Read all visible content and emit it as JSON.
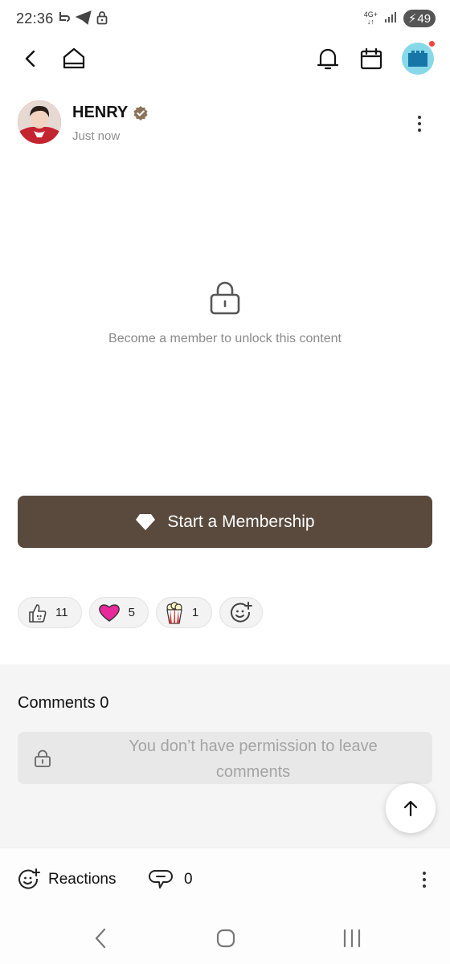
{
  "status_bar": {
    "time": "22:36",
    "network": "4G+",
    "battery": "49",
    "icons": [
      "sync-icon",
      "telegram-icon",
      "lock-icon",
      "signal-icon",
      "battery-icon"
    ]
  },
  "top_nav": {
    "icons": [
      "back-icon",
      "home-icon",
      "bell-icon",
      "calendar-icon",
      "profile-avatar"
    ],
    "has_notification_dot": true
  },
  "post": {
    "author_name": "HENRY",
    "verified": true,
    "timestamp": "Just now",
    "locked_message": "Become a member to unlock this content"
  },
  "membership_button": {
    "label": "Start a Membership",
    "color": "#5a4a3d"
  },
  "reactions": [
    {
      "icon": "thumbs-up-icon",
      "count": "11"
    },
    {
      "icon": "heart-icon",
      "count": "5"
    },
    {
      "icon": "popcorn-icon",
      "count": "1"
    }
  ],
  "comments": {
    "title": "Comments 0",
    "locked_message": "You don’t have permission to leave comments"
  },
  "bottom_bar": {
    "reactions_label": "Reactions",
    "comment_count": "0"
  },
  "colors": {
    "accent": "#5a4a3d",
    "heart": "#e8289b",
    "verified_badge": "#8a7356"
  }
}
